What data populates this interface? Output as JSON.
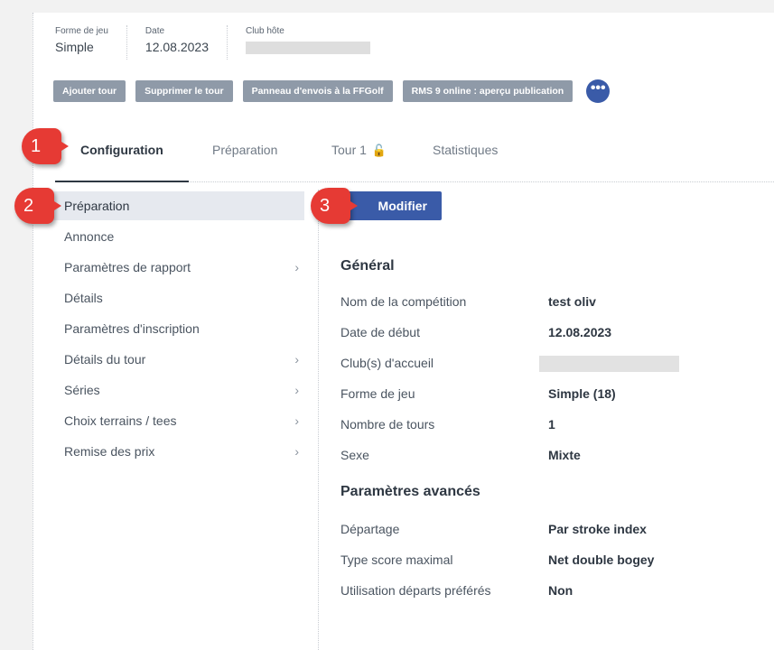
{
  "header": {
    "fields": [
      {
        "label": "Forme de jeu",
        "value": "Simple"
      },
      {
        "label": "Date",
        "value": "12.08.2023"
      },
      {
        "label": "Club hôte",
        "value": ""
      }
    ]
  },
  "actions": [
    "Ajouter tour",
    "Supprimer le tour",
    "Panneau d'envois à la FFGolf",
    "RMS 9 online : aperçu publication"
  ],
  "more_button": "•••",
  "tabs": [
    {
      "label": "Configuration",
      "active": true
    },
    {
      "label": "Préparation",
      "active": false
    },
    {
      "label": "Tour 1",
      "active": false,
      "icon": "lock-icon"
    },
    {
      "label": "Statistiques",
      "active": false
    }
  ],
  "sidebar": {
    "items": [
      {
        "label": "Préparation",
        "selected": true,
        "chevron": false
      },
      {
        "label": "Annonce",
        "selected": false,
        "chevron": false
      },
      {
        "label": "Paramètres de rapport",
        "selected": false,
        "chevron": true
      },
      {
        "label": "Détails",
        "selected": false,
        "chevron": false
      },
      {
        "label": "Paramètres d'inscription",
        "selected": false,
        "chevron": false
      },
      {
        "label": "Détails du tour",
        "selected": false,
        "chevron": true
      },
      {
        "label": "Séries",
        "selected": false,
        "chevron": true
      },
      {
        "label": "Choix terrains / tees",
        "selected": false,
        "chevron": true
      },
      {
        "label": "Remise des prix",
        "selected": false,
        "chevron": true
      }
    ]
  },
  "content": {
    "edit_label": "Modifier",
    "general_title": "Général",
    "general": [
      {
        "key": "Nom de la compétition",
        "value": "test oliv"
      },
      {
        "key": "Date de début",
        "value": "12.08.2023"
      },
      {
        "key": "Club(s) d'accueil",
        "value": ""
      },
      {
        "key": "Forme de jeu",
        "value": "Simple (18)"
      },
      {
        "key": "Nombre de tours",
        "value": "1"
      },
      {
        "key": "Sexe",
        "value": "Mixte"
      }
    ],
    "advanced_title": "Paramètres avancés",
    "advanced": [
      {
        "key": "Départage",
        "value": "Par stroke index"
      },
      {
        "key": "Type score maximal",
        "value": "Net double bogey"
      },
      {
        "key": "Utilisation départs préférés",
        "value": "Non"
      }
    ]
  },
  "callouts": [
    "1",
    "2",
    "3"
  ],
  "colors": {
    "accent": "#3a5ba8",
    "action_button": "#8f9aa8",
    "callout": "#e63a34",
    "selected_bg": "#e6e9ef"
  }
}
